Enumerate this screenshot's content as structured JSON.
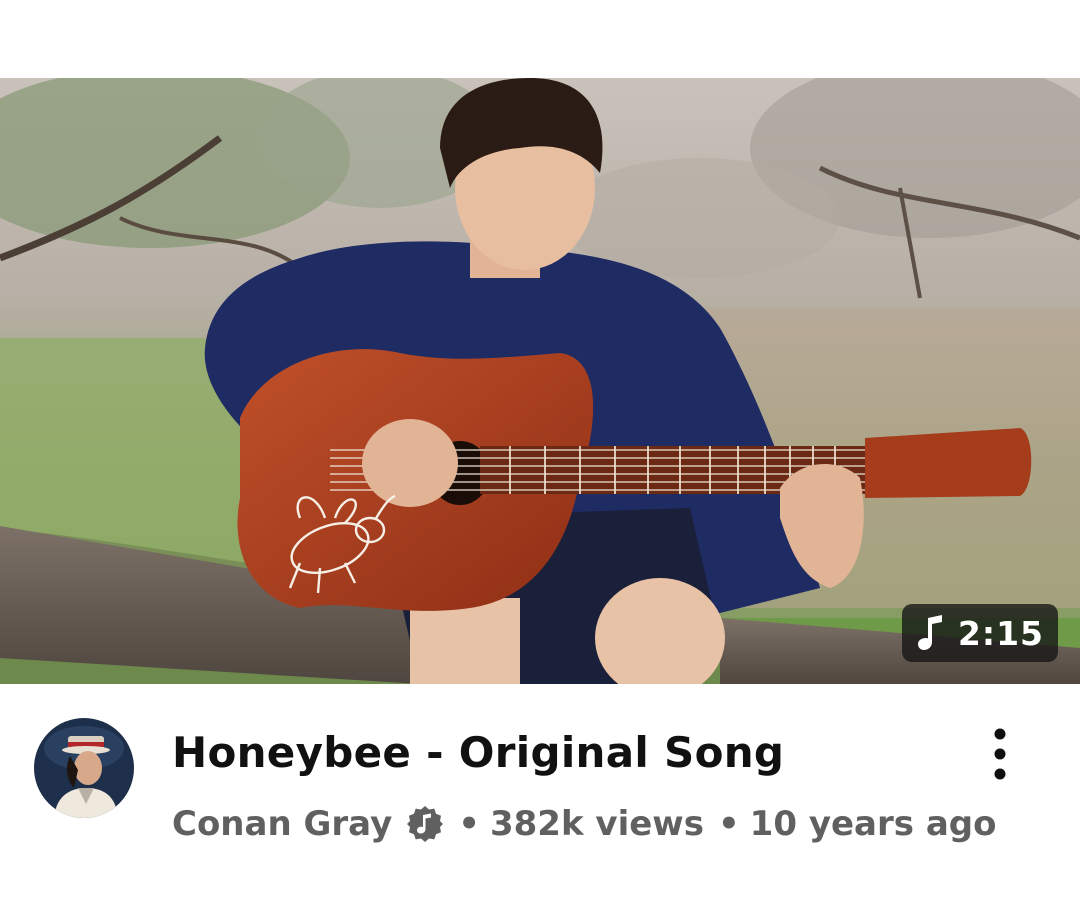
{
  "video": {
    "title": "Honeybee - Original Song",
    "channel": "Conan Gray",
    "views": "382k views",
    "age": "10 years ago",
    "duration": "2:15",
    "separator": "•"
  },
  "icons": {
    "duration": "music-note-icon",
    "verified": "music-verified-badge-icon",
    "menu": "vertical-dots-icon"
  },
  "colors": {
    "title": "#111111",
    "meta": "#606060",
    "badge_bg": "#141414"
  }
}
